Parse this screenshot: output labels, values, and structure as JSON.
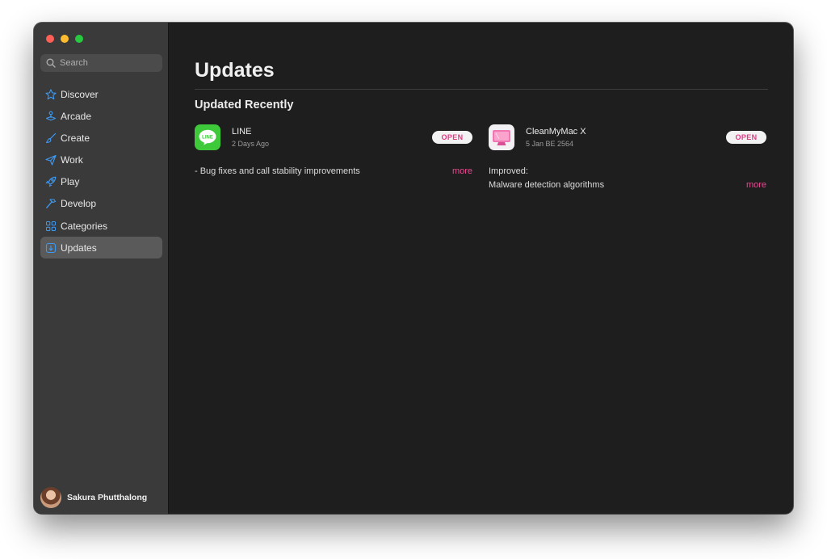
{
  "sidebar": {
    "search_placeholder": "Search",
    "items": [
      {
        "label": "Discover",
        "icon": "star-icon"
      },
      {
        "label": "Arcade",
        "icon": "joystick-icon"
      },
      {
        "label": "Create",
        "icon": "brush-icon"
      },
      {
        "label": "Work",
        "icon": "paper-plane-icon"
      },
      {
        "label": "Play",
        "icon": "rocket-icon"
      },
      {
        "label": "Develop",
        "icon": "hammer-icon"
      },
      {
        "label": "Categories",
        "icon": "grid-icon"
      },
      {
        "label": "Updates",
        "icon": "download-icon",
        "active": true
      }
    ],
    "user_name": "Sakura Phutthalong"
  },
  "main": {
    "title": "Updates",
    "section_title": "Updated Recently",
    "apps": [
      {
        "name": "LINE",
        "date": "2 Days Ago",
        "button": "OPEN",
        "notes": [
          "- Bug fixes and call stability improvements"
        ],
        "more": "more",
        "icon": "line-app-icon"
      },
      {
        "name": "CleanMyMac X",
        "date": "5 Jan BE 2564",
        "button": "OPEN",
        "notes": [
          "Improved:",
          "Malware detection algorithms"
        ],
        "more": "more",
        "icon": "cleanmymac-app-icon"
      }
    ]
  },
  "colors": {
    "accent": "#e84a91",
    "sidebar_icon": "#3d9bf5",
    "background": "#1e1e1e",
    "sidebar_bg": "#3a3a3a"
  }
}
